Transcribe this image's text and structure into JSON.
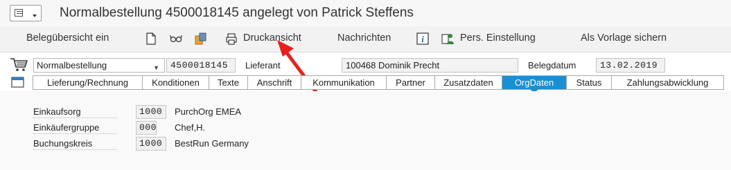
{
  "window": {
    "title": "Normalbestellung 4500018145 angelegt von Patrick Steffens"
  },
  "toolbar": {
    "document_overview": "Belegübersicht ein",
    "print_preview": "Druckansicht",
    "messages": "Nachrichten",
    "personal_settings": "Pers. Einstellung",
    "save_as_template": "Als Vorlage sichern"
  },
  "header": {
    "doc_type": "Normalbestellung",
    "po_number": "4500018145",
    "vendor_label": "Lieferant",
    "vendor_value": "100468 Dominik Precht",
    "doc_date_label": "Belegdatum",
    "doc_date_value": "13.02.2019"
  },
  "tabs": [
    {
      "label": "Lieferung/Rechnung"
    },
    {
      "label": "Konditionen"
    },
    {
      "label": "Texte"
    },
    {
      "label": "Anschrift"
    },
    {
      "label": "Kommunikation"
    },
    {
      "label": "Partner"
    },
    {
      "label": "Zusatzdaten"
    },
    {
      "label": "OrgDaten",
      "active": true
    },
    {
      "label": "Status"
    },
    {
      "label": "Zahlungsabwicklung"
    }
  ],
  "org_data": [
    {
      "label": "Einkaufsorg",
      "code": "1000",
      "text": "PurchOrg EMEA"
    },
    {
      "label": "Einkäufergruppe",
      "code": "000",
      "text": "Chef,H."
    },
    {
      "label": "Buchungskreis",
      "code": "1000",
      "text": "BestRun Germany"
    }
  ],
  "colors": {
    "active_tab": "#1a8fd3",
    "annotation_arrow": "#e3231b"
  }
}
